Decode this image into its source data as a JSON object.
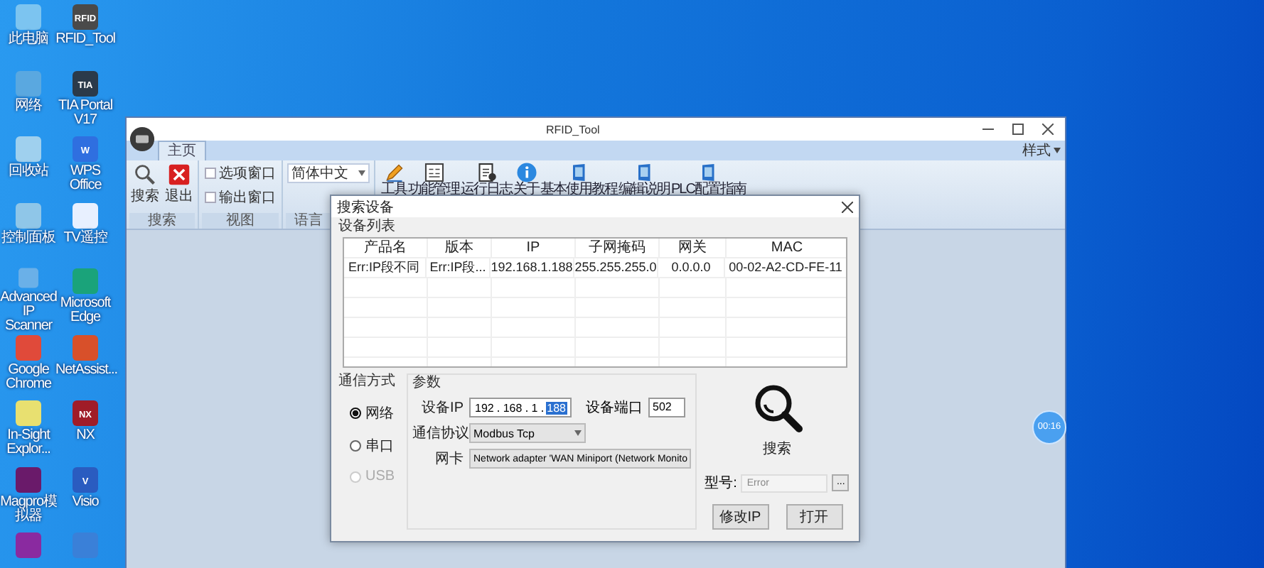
{
  "desktop_icons": [
    {
      "label": "此电脑",
      "color": "#7cc4f0"
    },
    {
      "label": "网络",
      "color": "#5aa8e0"
    },
    {
      "label": "回收站",
      "color": "#9fd0ee"
    },
    {
      "label": "控制面板",
      "color": "#8fc6e8"
    },
    {
      "label": "Advanced IP Scanner",
      "color": "#6ab0e8"
    },
    {
      "label": "Google Chrome",
      "color": "#e04a3a"
    },
    {
      "label": "In-Sight Explor...",
      "color": "#e8e070"
    },
    {
      "label": "Magpro模拟器",
      "color": "#6a1a6a"
    },
    {
      "color": "#8a2aa0"
    },
    {
      "label": "RFID_Tool",
      "color": "#4a4a4a",
      "glyph": "RFID"
    },
    {
      "label": "TIA Portal V17",
      "color": "#2b3a4a",
      "glyph": "TIA"
    },
    {
      "label": "WPS Office",
      "color": "#2f6fe0",
      "glyph": "W"
    },
    {
      "label": "TV遥控",
      "color": "#e8f0ff"
    },
    {
      "label": "Microsoft Edge",
      "color": "#1aa37a"
    },
    {
      "label": "NetAssist...",
      "color": "#d8502a"
    },
    {
      "label": "NX",
      "color": "#a01c28",
      "glyph": "NX"
    },
    {
      "label": "Visio",
      "color": "#2a5cc0",
      "glyph": "V"
    },
    {
      "color": "#3a80d8"
    }
  ],
  "window": {
    "title": "RFID_Tool",
    "style_menu": "样式",
    "tabs": [
      {
        "label": "主页",
        "selected": true
      }
    ],
    "groups": [
      {
        "label": "搜索",
        "kind": "buttons",
        "items": [
          {
            "label": "搜索"
          },
          {
            "label": "退出"
          }
        ]
      },
      {
        "label": "视图",
        "kind": "checks",
        "items": [
          {
            "label": "选项窗口",
            "checked": false
          },
          {
            "label": "输出窗口",
            "checked": false
          }
        ]
      },
      {
        "label": "语言",
        "kind": "select",
        "value": "简体中文"
      }
    ],
    "tools": [
      {
        "label": "工具"
      },
      {
        "label": "功能管理"
      },
      {
        "label": "运行日志"
      },
      {
        "label": "关于"
      },
      {
        "label": "基本使用教程"
      },
      {
        "label": "编辑说明"
      },
      {
        "label": "PLC配置指南"
      }
    ]
  },
  "dialog": {
    "title": "搜索设备",
    "device_list": {
      "title": "设备列表",
      "columns": [
        "产品名",
        "版本",
        "IP",
        "子网掩码",
        "网关",
        "MAC"
      ],
      "rows": [
        [
          "Err:IP段不同",
          "Err:IP段...",
          "192.168.1.188",
          "255.255.255.0",
          "0.0.0.0",
          "00-02-A2-CD-FE-11"
        ]
      ]
    },
    "comm": {
      "title": "通信方式",
      "options": [
        {
          "label": "网络",
          "selected": true,
          "disabled": false
        },
        {
          "label": "串口",
          "selected": false,
          "disabled": false
        },
        {
          "label": "USB",
          "selected": false,
          "disabled": true
        }
      ]
    },
    "params": {
      "title": "参数",
      "ip_label": "设备IP",
      "ip": [
        {
          "value": "192",
          "selected": false
        },
        {
          "value": "168",
          "selected": false
        },
        {
          "value": "1",
          "selected": false
        },
        {
          "value": "188",
          "selected": true
        }
      ],
      "port_label": "设备端口",
      "port": "502",
      "protocol_label": "通信协议",
      "protocol": "Modbus Tcp",
      "nic_label": "网卡",
      "nic": "Network adapter 'WAN Miniport (Network Monito"
    },
    "search_label": "搜索",
    "model_label": "型号:",
    "model_value": "Error",
    "browse": "...",
    "buttons": [
      "修改IP",
      "打开"
    ]
  },
  "clock": "00:16"
}
